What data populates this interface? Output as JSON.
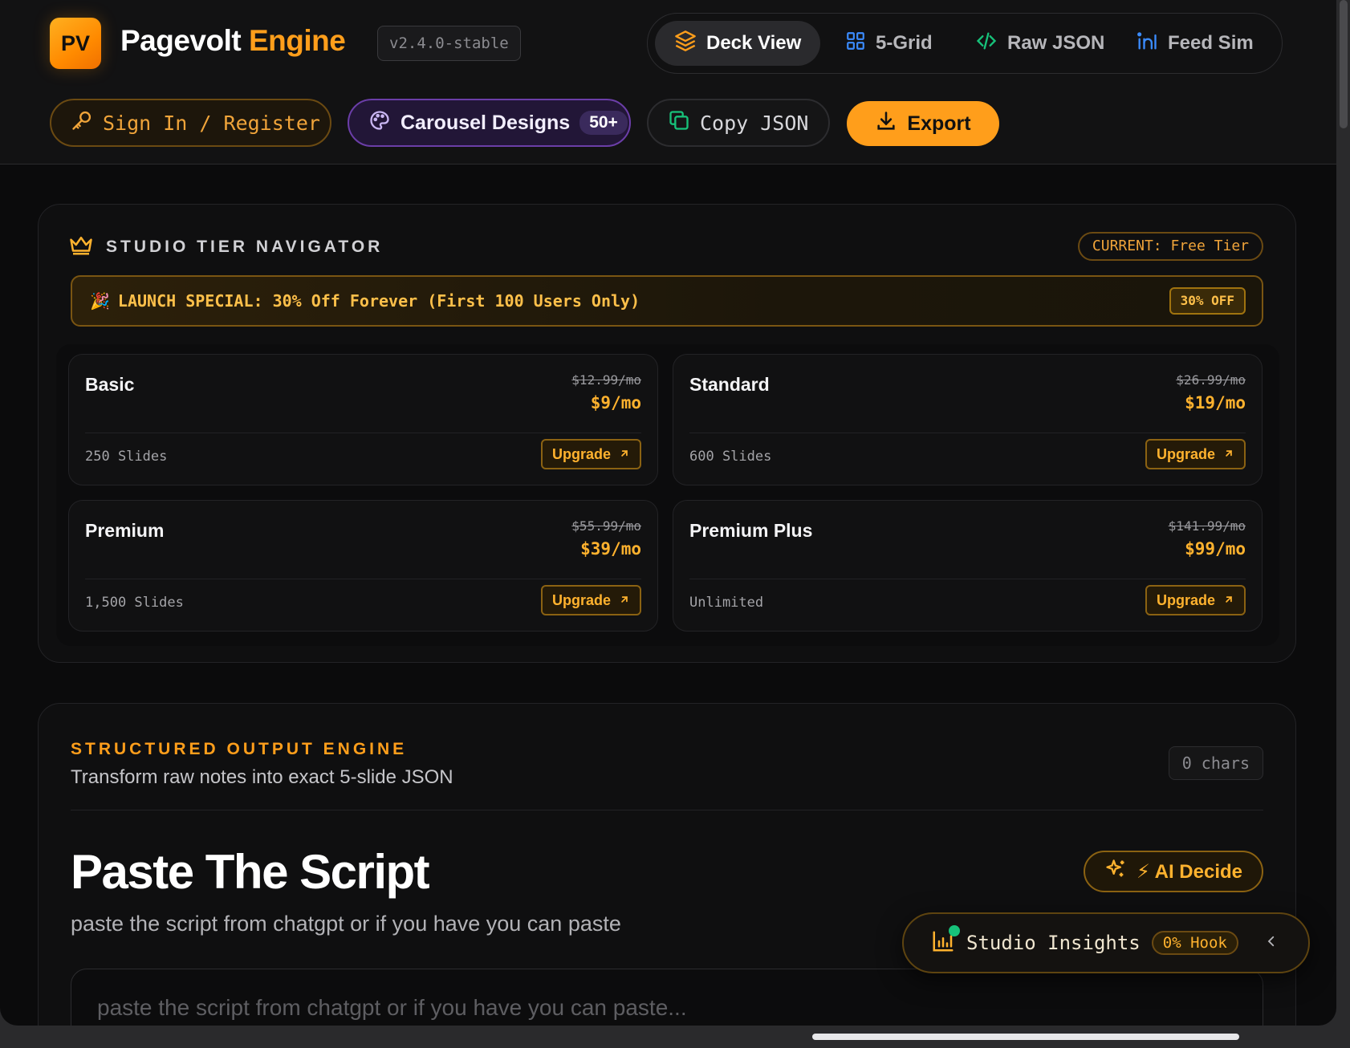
{
  "brand": {
    "logo_text": "PV",
    "name_white": "Pagevolt",
    "name_orange": "Engine",
    "version": "v2.4.0-stable"
  },
  "view_tabs": [
    {
      "label": "Deck View",
      "icon": "layers-icon",
      "active": true
    },
    {
      "label": "5-Grid",
      "icon": "grid-icon",
      "active": false
    },
    {
      "label": "Raw JSON",
      "icon": "code-icon",
      "active": false
    },
    {
      "label": "Feed Sim",
      "icon": "linkedin-icon",
      "active": false
    }
  ],
  "actions": {
    "sign_in": "Sign In / Register",
    "designs": "Carousel Designs",
    "designs_badge": "50+",
    "copy_json": "Copy JSON",
    "export": "Export"
  },
  "tier_navigator": {
    "title": "STUDIO TIER NAVIGATOR",
    "current": "CURRENT: Free Tier",
    "launch_text": "LAUNCH SPECIAL: 30% Off Forever (First 100 Users Only)",
    "launch_emoji": "🎉",
    "launch_badge": "30% OFF",
    "upgrade_label": "Upgrade",
    "tiers": [
      {
        "name": "Basic",
        "old_price": "$12.99/mo",
        "price": "$9/mo",
        "slides": "250 Slides"
      },
      {
        "name": "Standard",
        "old_price": "$26.99/mo",
        "price": "$19/mo",
        "slides": "600 Slides"
      },
      {
        "name": "Premium",
        "old_price": "$55.99/mo",
        "price": "$39/mo",
        "slides": "1,500 Slides"
      },
      {
        "name": "Premium Plus",
        "old_price": "$141.99/mo",
        "price": "$99/mo",
        "slides": "Unlimited"
      }
    ]
  },
  "structured_output": {
    "eyebrow": "STRUCTURED OUTPUT ENGINE",
    "subtitle": "Transform raw notes into exact 5-slide JSON",
    "char_count": "0 chars",
    "heading": "Paste The Script",
    "description": "paste the script from chatgpt or if you have you can paste",
    "ai_decide": "⚡ AI Decide",
    "input_placeholder": "paste the script from chatgpt or if you have you can paste..."
  },
  "insights": {
    "label": "Studio Insights",
    "hook": "0% Hook",
    "status_color": "#17c27a"
  },
  "colors": {
    "accent": "#ff9e1b",
    "purple": "#6b3ea8",
    "background": "#0b0b0c"
  }
}
